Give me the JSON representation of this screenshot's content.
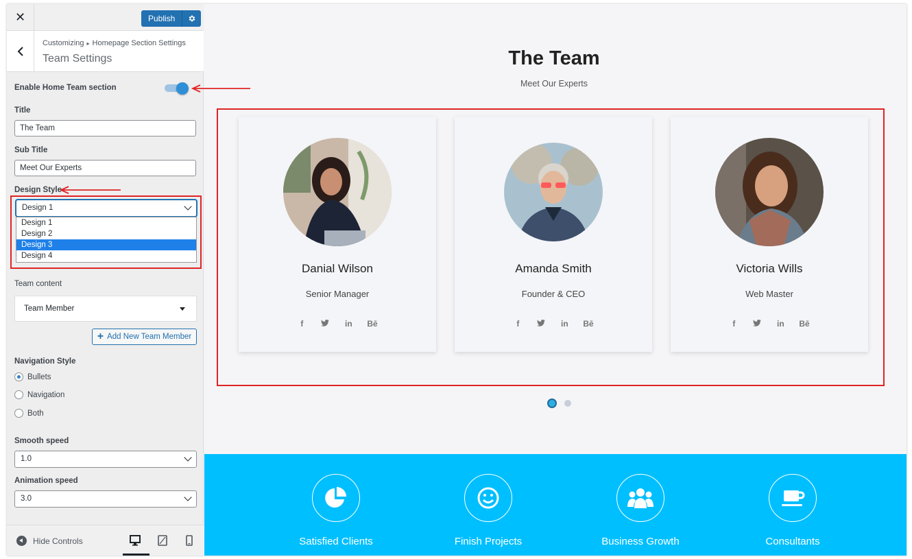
{
  "sidebar": {
    "close_glyph": "✕",
    "publish_label": "Publish",
    "breadcrumb_root": "Customizing",
    "breadcrumb_sep": "▸",
    "breadcrumb_parent": "Homepage Section Settings",
    "section_title": "Team Settings",
    "enable_label": "Enable Home Team section",
    "enable_on": true,
    "title_label": "Title",
    "title_value": "The Team",
    "subtitle_label": "Sub Title",
    "subtitle_value": "Meet Our Experts",
    "design_label": "Design Style",
    "design_value": "Design 1",
    "design_options": [
      "Design 1",
      "Design 2",
      "Design 3",
      "Design 4"
    ],
    "design_highlighted": "Design 3",
    "team_content_label": "Team content",
    "team_member_label": "Team Member",
    "add_member_label": "Add New Team Member",
    "nav_style_label": "Navigation Style",
    "nav_options": [
      "Bullets",
      "Navigation",
      "Both"
    ],
    "nav_selected": "Bullets",
    "smooth_label": "Smooth speed",
    "smooth_value": "1.0",
    "anim_label": "Animation speed",
    "anim_value": "3.0",
    "hide_controls_label": "Hide Controls"
  },
  "preview": {
    "title": "The Team",
    "subtitle": "Meet Our Experts",
    "members": [
      {
        "name": "Danial Wilson",
        "role": "Senior Manager"
      },
      {
        "name": "Amanda Smith",
        "role": "Founder & CEO"
      },
      {
        "name": "Victoria Wills",
        "role": "Web Master"
      }
    ],
    "social_glyphs": [
      "f",
      "t",
      "in",
      "Bē"
    ],
    "slider_dots": 2,
    "active_dot": 1,
    "stats": [
      "Satisfied Clients",
      "Finish Projects",
      "Business Growth",
      "Consultants"
    ]
  },
  "colors": {
    "accent": "#2271b1",
    "annotation": "#e02424",
    "stats_bg": "#00bfff",
    "dropdown_highlight": "#1e80e8"
  }
}
